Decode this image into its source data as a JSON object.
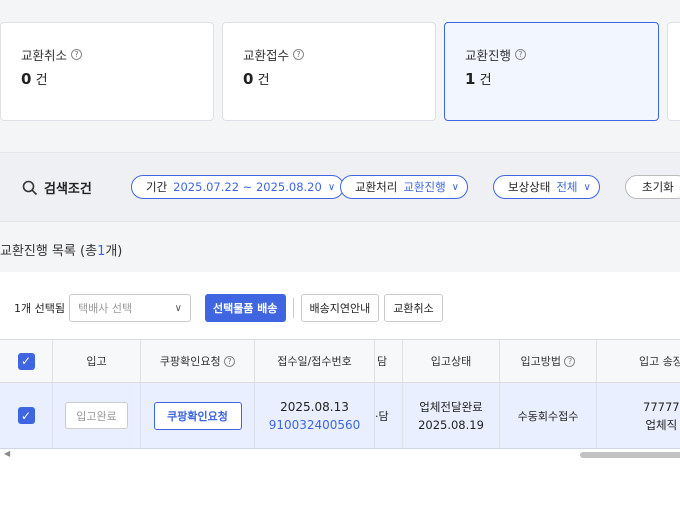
{
  "stats": [
    {
      "title": "교환취소",
      "value": "0",
      "unit": "건",
      "active": false
    },
    {
      "title": "교환접수",
      "value": "0",
      "unit": "건",
      "active": false
    },
    {
      "title": "교환진행",
      "value": "1",
      "unit": "건",
      "active": true
    }
  ],
  "search": {
    "label": "검색조건",
    "filters": [
      {
        "key": "기간",
        "value": "2025.07.22 ~ 2025.08.20"
      },
      {
        "key": "교환처리",
        "value": "교환진행"
      },
      {
        "key": "보상상태",
        "value": "전체"
      }
    ],
    "reset_label": "초기화"
  },
  "list": {
    "title_prefix": "교환진행 목록 (총",
    "count": "1",
    "title_suffix": "개)"
  },
  "toolbar": {
    "selected_text": "1개 선택됨",
    "courier_placeholder": "택배사 선택",
    "ship_label": "선택물품 배송",
    "delay_label": "배송지연안내",
    "cancel_label": "교환취소"
  },
  "table": {
    "headers": [
      "입고",
      "쿠팡확인요청",
      "접수일/접수번호",
      "담",
      "입고상태",
      "입고방법",
      "입고 송장"
    ],
    "row": {
      "inbox_label": "입고완료",
      "coupang_label": "쿠팡확인요청",
      "receipt_date": "2025.08.13",
      "receipt_no": "910032400560",
      "partial": "·담",
      "status_line1": "업체전달완료",
      "status_line2": "2025.08.19",
      "method": "수동회수접수",
      "invoice_line1": "77777",
      "invoice_line2": "업체직"
    }
  },
  "colors": {
    "accent": "#3f66e0"
  }
}
